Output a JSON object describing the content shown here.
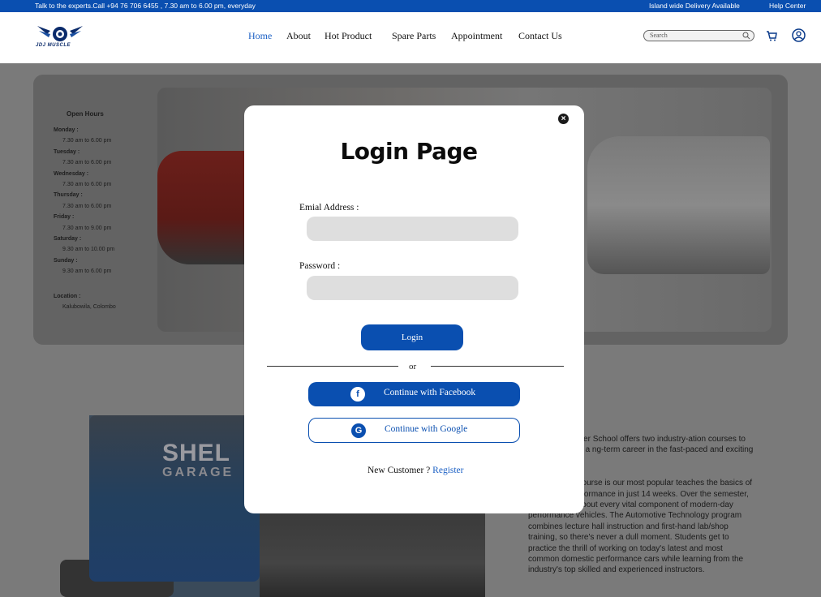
{
  "topbar": {
    "tagline": "Talk to the experts.Call +94 76 706 6455 , 7.30 am to 6.00 pm, everyday",
    "delivery": "Island wide Delivery Available",
    "help": "Help Center"
  },
  "brand": {
    "logo_text": "JDJ MUSCLE"
  },
  "nav": {
    "items": [
      {
        "label": "Home",
        "active": true
      },
      {
        "label": "About"
      },
      {
        "label": "Hot Product"
      },
      {
        "label": "Spare Parts"
      },
      {
        "label": "Appointment"
      },
      {
        "label": "Contact Us"
      }
    ]
  },
  "search": {
    "placeholder": "Search"
  },
  "colors": {
    "primary": "#0a4fb0",
    "link": "#1a5fc4",
    "field": "#dedede"
  },
  "hours": {
    "title": "Open Hours",
    "days": [
      {
        "day": "Monday :",
        "time": "7.30 am to 6.00 pm"
      },
      {
        "day": "Tuesday :",
        "time": "7.30 am to 6.00 pm"
      },
      {
        "day": "Wednesday :",
        "time": "7.30 am to 6.00 pm"
      },
      {
        "day": "Thursday :",
        "time": "7.30 am to 6.00 pm"
      },
      {
        "day": "Friday :",
        "time": "7.30 am to 9.00 pm"
      },
      {
        "day": "Saturday :",
        "time": "9.30 am to 10.00 pm"
      },
      {
        "day": "Sunday :",
        "time": "9.30 am to 6.00 pm"
      }
    ],
    "location_label": "Location :",
    "location": "Kalubowila, Colombo"
  },
  "lower": {
    "shelby": "SHEL",
    "garage": "GARAGE",
    "para1": "formance's Tuner School offers two industry-ation courses to prepare you for a ng-term career in the fast-paced and exciting notive tuning!",
    "para2": "e Technology course is our most popular teaches the basics of automotive performance in just 14 weeks. Over the semester, you will learn about every vital component of modern-day performance vehicles. The Automotive Technology program combines lecture hall instruction and first-hand lab/shop training, so there's never a dull moment. Students get to practice the thrill of working on today's latest and most common domestic performance cars while learning from the industry's top skilled and experienced instructors."
  },
  "modal": {
    "close": "×",
    "title": "Login Page",
    "email_label": "Emial Address :",
    "password_label": "Password :",
    "login_button": "Login",
    "or": "or",
    "facebook_button": "Continue with Facebook",
    "google_button": "Continue with Google",
    "new_customer": "New Customer ?",
    "register": "Register"
  }
}
